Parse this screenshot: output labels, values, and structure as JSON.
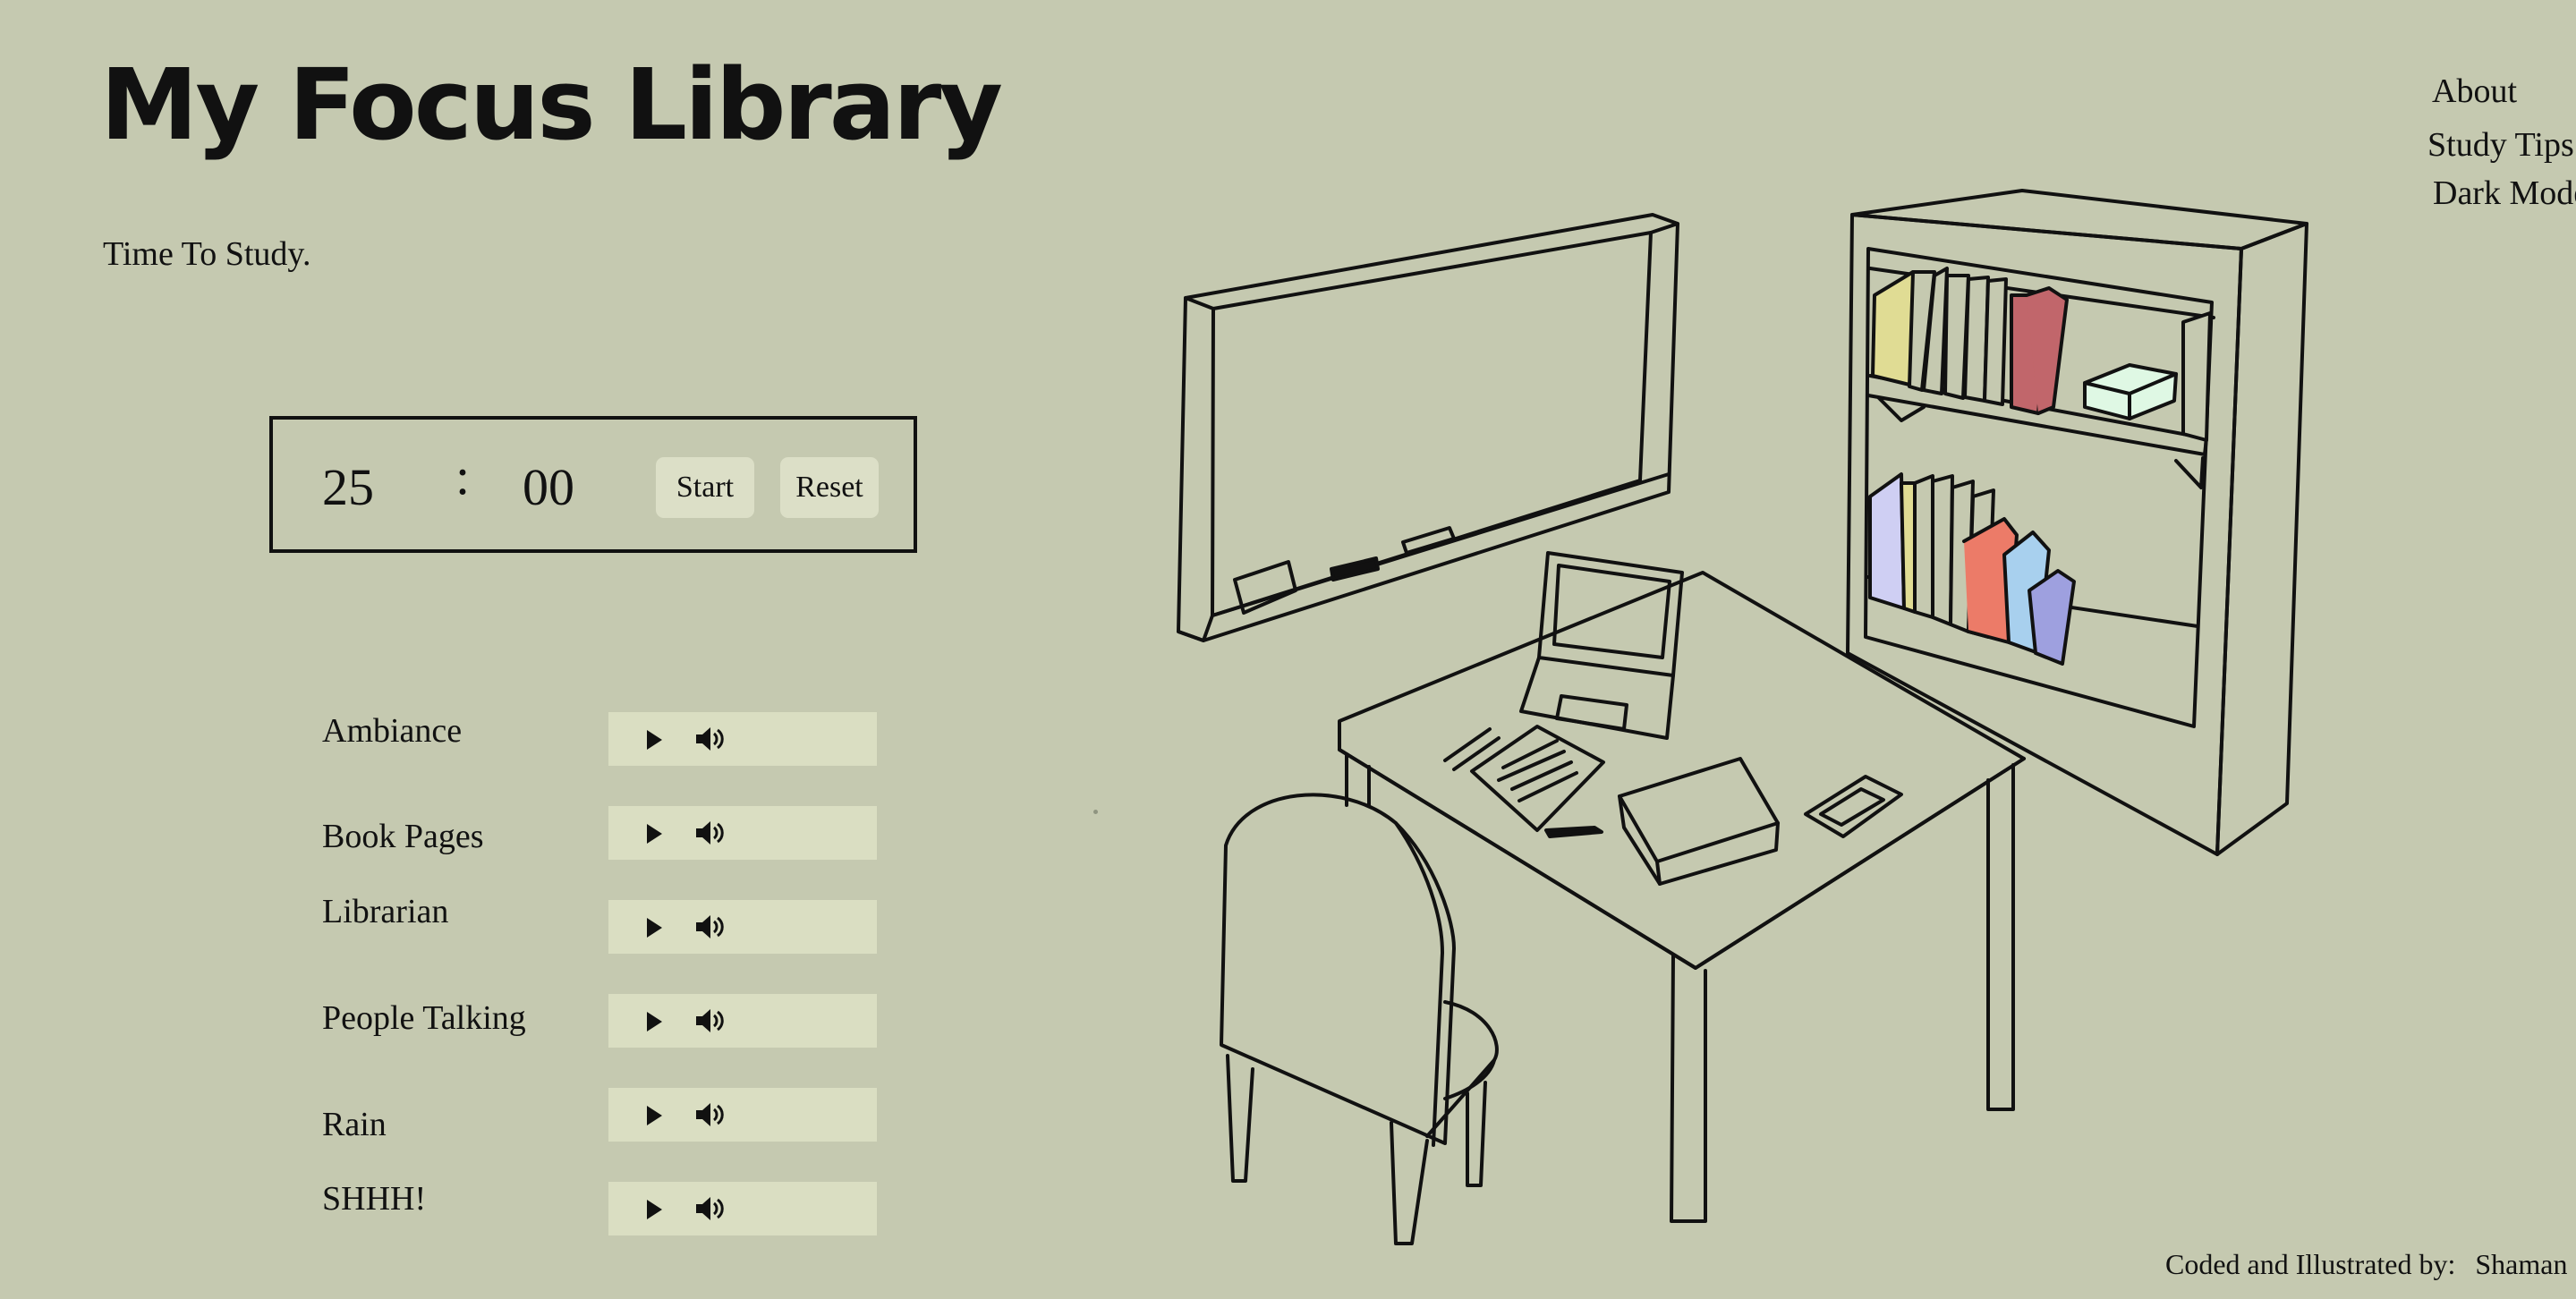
{
  "header": {
    "title": "My Focus Library",
    "subtitle": "Time To Study."
  },
  "nav": {
    "about": "About",
    "study_tips": "Study Tips",
    "dark_mode": "Dark Mode"
  },
  "timer": {
    "minutes": "25",
    "separator": ":",
    "seconds": "00",
    "start_label": "Start",
    "reset_label": "Reset"
  },
  "sounds": [
    {
      "label": "Ambiance"
    },
    {
      "label": "Book Pages"
    },
    {
      "label": "Librarian"
    },
    {
      "label": "People Talking"
    },
    {
      "label": "Rain"
    },
    {
      "label": "SHHH!"
    }
  ],
  "footer": {
    "credit_prefix": "Coded and Illustrated by:",
    "credit_name": "Shaman"
  },
  "colors": {
    "background": "#c5c9b0",
    "button_bg": "#dcdfc7",
    "player_bg": "#dadec2",
    "book_yellow": "#e0dc94",
    "book_red": "#c1666b",
    "book_lavender": "#cfcff3",
    "book_coral": "#ec7b68",
    "book_blue": "#a8d0ee",
    "book_purple": "#9ea0df",
    "box_mint": "#dff8e4"
  },
  "icons": [
    "play-icon",
    "volume-icon"
  ]
}
